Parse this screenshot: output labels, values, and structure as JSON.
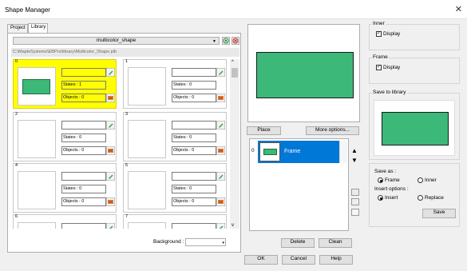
{
  "window": {
    "title": "Shape Manager",
    "close_glyph": "✕"
  },
  "tabs": [
    {
      "label": "Project"
    },
    {
      "label": "Library"
    }
  ],
  "library": {
    "selected": "multicolor_shape",
    "path": "C:\\MapleSystems\\EBPro\\library\\Multicolor_Shape.plb"
  },
  "cells": [
    {
      "index": "0",
      "states": "States : 1",
      "objects": "Objects : 0",
      "selected": true
    },
    {
      "index": "1",
      "states": "States : 0",
      "objects": "Objects : 0"
    },
    {
      "index": "2",
      "states": "States : 0",
      "objects": "Objects : 0"
    },
    {
      "index": "3",
      "states": "States : 0",
      "objects": "Objects : 0"
    },
    {
      "index": "4",
      "states": "States : 0",
      "objects": "Objects : 0"
    },
    {
      "index": "5",
      "states": "States : 0",
      "objects": "Objects : 0"
    },
    {
      "index": "6"
    },
    {
      "index": "7"
    }
  ],
  "background_label": "Background :",
  "buttons": {
    "place": "Place",
    "more_options": "More options...",
    "delete": "Delete",
    "clean": "Clean",
    "ok": "OK",
    "cancel": "Cancel",
    "help": "Help",
    "save": "Save"
  },
  "frame_list": [
    {
      "index": "0",
      "label": "Frame"
    }
  ],
  "inner_group": {
    "title": "Inner",
    "display_label": "Display",
    "display_checked": true
  },
  "frame_group": {
    "title": "Frame",
    "display_label": "Display",
    "display_checked": true
  },
  "save_library": {
    "title": "Save to library"
  },
  "save_as": {
    "label": "Save as :",
    "options": [
      "Frame",
      "Inner"
    ],
    "selected": "Frame"
  },
  "insert_options": {
    "label": "Insert options :",
    "options": [
      "Insert",
      "Replace"
    ],
    "selected": "Insert"
  },
  "colors": {
    "shape_fill": "#3cb878",
    "selection": "#ffff00",
    "list_highlight": "#0078d7"
  },
  "icons": [
    "pencil-icon",
    "picture-icon",
    "arrow-up-icon",
    "arrow-down-icon",
    "chevron-down-icon"
  ]
}
